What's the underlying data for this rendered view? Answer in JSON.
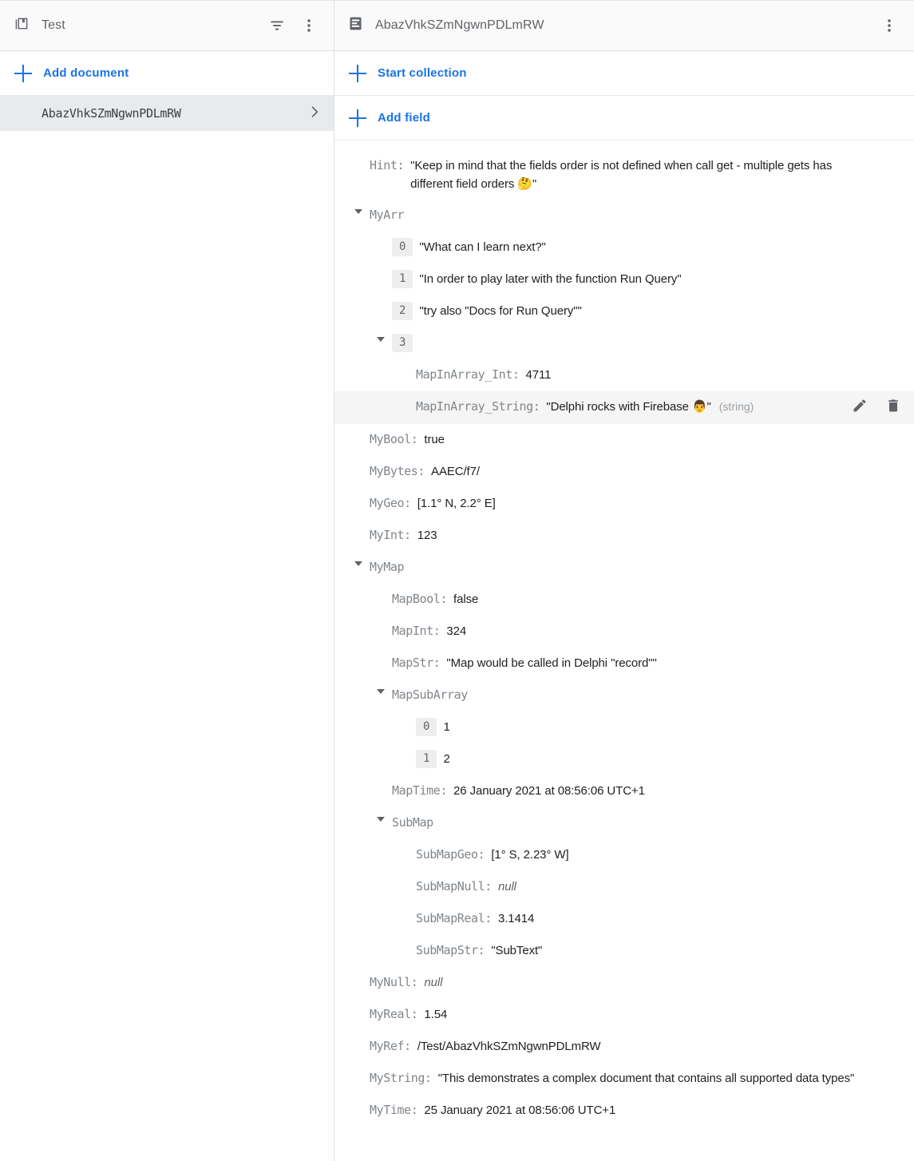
{
  "left_panel": {
    "header": {
      "icon": "collections-icon",
      "title": "Test",
      "filter_icon": "filter-list-icon",
      "menu_icon": "more-vert-icon"
    },
    "add_document_label": "Add document",
    "documents": [
      {
        "id": "AbazVhkSZmNgwnPDLmRW",
        "selected": true
      }
    ]
  },
  "right_panel": {
    "header": {
      "icon": "document-icon",
      "title": "AbazVhkSZmNgwnPDLmRW",
      "menu_icon": "more-vert-icon"
    },
    "start_collection_label": "Start collection",
    "add_field_label": "Add field",
    "fields": [
      {
        "key": "Hint:",
        "value": "\"Keep in mind that the fields order is not defined when call get - multiple gets has different field orders 🤔\"",
        "indent": 0,
        "twisty": false
      },
      {
        "key": "MyArr",
        "value": "",
        "indent": 0,
        "twisty": true
      },
      {
        "index": "0",
        "value": "\"What can I learn next?\"",
        "indent": 1,
        "twisty": false
      },
      {
        "index": "1",
        "value": "\"In order to play later with the function Run Query\"",
        "indent": 1,
        "twisty": false
      },
      {
        "index": "2",
        "value": "\"try also \"Docs for Run Query\"\"",
        "indent": 1,
        "twisty": false
      },
      {
        "index": "3",
        "value": "",
        "indent": 1,
        "twisty": true
      },
      {
        "key": "MapInArray_Int:",
        "value": "4711",
        "indent": 2,
        "twisty": false
      },
      {
        "key": "MapInArray_String:",
        "value": "\"Delphi rocks with Firebase 👨\"",
        "type": "(string)",
        "indent": 2,
        "twisty": false,
        "hovered": true,
        "edit_icon": "pencil-icon",
        "delete_icon": "trash-icon"
      },
      {
        "key": "MyBool:",
        "value": "true",
        "indent": 0,
        "twisty": false
      },
      {
        "key": "MyBytes:",
        "value": "AAEC/f7/",
        "indent": 0,
        "twisty": false
      },
      {
        "key": "MyGeo:",
        "value": "[1.1° N, 2.2° E]",
        "indent": 0,
        "twisty": false
      },
      {
        "key": "MyInt:",
        "value": "123",
        "indent": 0,
        "twisty": false
      },
      {
        "key": "MyMap",
        "value": "",
        "indent": 0,
        "twisty": true
      },
      {
        "key": "MapBool:",
        "value": "false",
        "indent": 1,
        "twisty": false
      },
      {
        "key": "MapInt:",
        "value": "324",
        "indent": 1,
        "twisty": false
      },
      {
        "key": "MapStr:",
        "value": "\"Map would be called in Delphi \"record\"\"",
        "indent": 1,
        "twisty": false
      },
      {
        "key": "MapSubArray",
        "value": "",
        "indent": 1,
        "twisty": true
      },
      {
        "index": "0",
        "value": "1",
        "indent": 2,
        "twisty": false
      },
      {
        "index": "1",
        "value": "2",
        "indent": 2,
        "twisty": false
      },
      {
        "key": "MapTime:",
        "value": "26 January 2021 at 08:56:06 UTC+1",
        "indent": 1,
        "twisty": false
      },
      {
        "key": "SubMap",
        "value": "",
        "indent": 1,
        "twisty": true
      },
      {
        "key": "SubMapGeo:",
        "value": "[1° S, 2.23° W]",
        "indent": 2,
        "twisty": false
      },
      {
        "key": "SubMapNull:",
        "value": "null",
        "indent": 2,
        "twisty": false,
        "null": true
      },
      {
        "key": "SubMapReal:",
        "value": "3.1414",
        "indent": 2,
        "twisty": false
      },
      {
        "key": "SubMapStr:",
        "value": "\"SubText\"",
        "indent": 2,
        "twisty": false
      },
      {
        "key": "MyNull:",
        "value": "null",
        "indent": 0,
        "twisty": false,
        "null": true
      },
      {
        "key": "MyReal:",
        "value": "1.54",
        "indent": 0,
        "twisty": false
      },
      {
        "key": "MyRef:",
        "value": "/Test/AbazVhkSZmNgwnPDLmRW",
        "indent": 0,
        "twisty": false
      },
      {
        "key": "MyString:",
        "value": "\"This demonstrates a complex document that contains all supported data types\"",
        "indent": 0,
        "twisty": false,
        "wrap_width": 540
      },
      {
        "key": "MyTime:",
        "value": "25 January 2021 at 08:56:06 UTC+1",
        "indent": 0,
        "twisty": false
      }
    ]
  },
  "colors": {
    "accent": "#1a73e8",
    "key_text": "#80868b",
    "value_text": "#202124",
    "header_bg": "#fafafa",
    "selected_bg": "#e8eaed",
    "hover_bg": "#f5f5f5",
    "badge_bg": "#eeeeee"
  }
}
